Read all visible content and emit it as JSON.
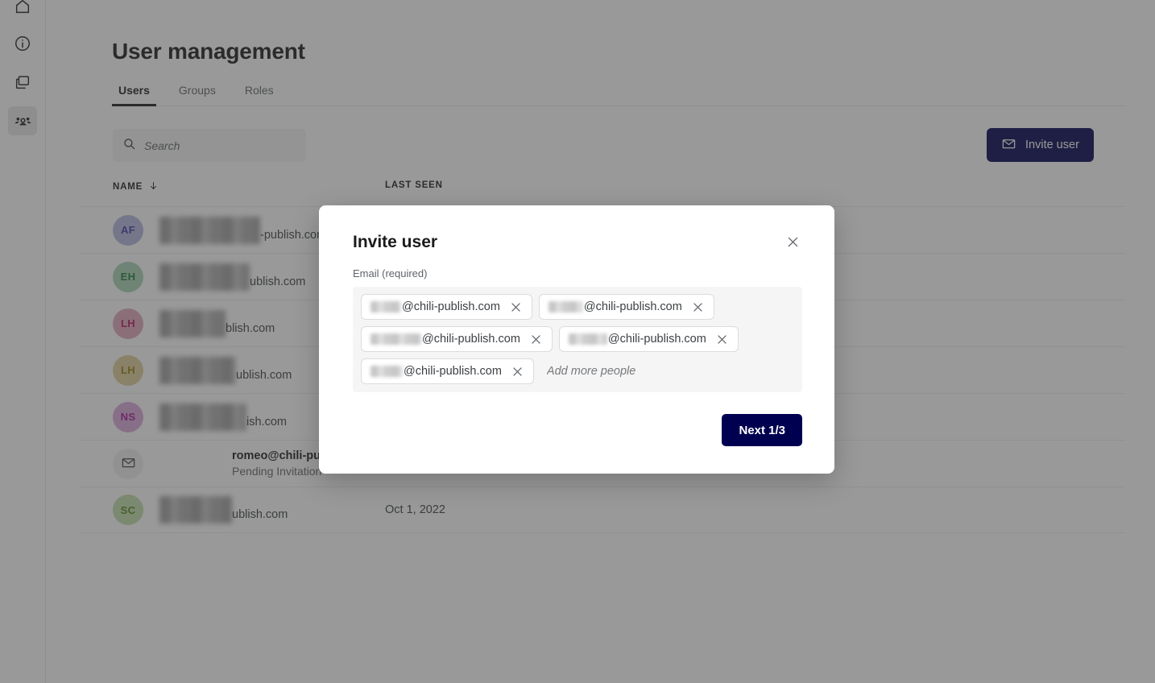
{
  "sidebar": {
    "items": [
      {
        "name": "home",
        "icon": "home-icon",
        "active": false
      },
      {
        "name": "info",
        "icon": "info-icon",
        "active": false
      },
      {
        "name": "workspaces",
        "icon": "window-stack-icon",
        "active": false
      },
      {
        "name": "user-management",
        "icon": "users-icon",
        "active": true
      }
    ]
  },
  "page": {
    "title": "User management",
    "tabs": [
      {
        "label": "Users",
        "active": true
      },
      {
        "label": "Groups",
        "active": false
      },
      {
        "label": "Roles",
        "active": false
      }
    ]
  },
  "toolbar": {
    "search_placeholder": "Search",
    "search_value": "",
    "search_icon": "search-icon",
    "invite_label": "Invite user",
    "invite_icon": "envelope-icon"
  },
  "table": {
    "columns": [
      {
        "key": "name",
        "label": "NAME",
        "sorted": true,
        "sort_icon": "arrow-down-icon"
      },
      {
        "key": "last_seen",
        "label": "LAST SEEN"
      }
    ],
    "rows": [
      {
        "initials": "AF",
        "avatar_color": "#b3b6de",
        "avatar_text_color": "#3f3fa8",
        "name_redacted": true,
        "name_blur_width": 125,
        "name_tail": "-publish.com",
        "badges": [
          "crown-icon",
          "pen-nib-icon"
        ],
        "last_seen": ""
      },
      {
        "initials": "EH",
        "avatar_color": "#a8d3b4",
        "avatar_text_color": "#1e7a44",
        "name_redacted": true,
        "name_blur_width": 112,
        "name_tail": "ublish.com",
        "badges": [],
        "last_seen": ""
      },
      {
        "initials": "LH",
        "avatar_color": "#dfa8bd",
        "avatar_text_color": "#b01a5a",
        "name_redacted": true,
        "name_blur_width": 82,
        "name_tail": "blish.com",
        "badges": [],
        "last_seen": ""
      },
      {
        "initials": "LH",
        "avatar_color": "#ddd09a",
        "avatar_text_color": "#9a7d0a",
        "name_redacted": true,
        "name_blur_width": 95,
        "name_tail": "ublish.com",
        "badges": [],
        "last_seen": ""
      },
      {
        "initials": "NS",
        "avatar_color": "#d9aad9",
        "avatar_text_color": "#a6199b",
        "name_redacted": true,
        "name_blur_width": 108,
        "name_tail": "ish.com",
        "badges": [],
        "last_seen": ""
      },
      {
        "initials": "",
        "avatar_color": "#eeeeee",
        "avatar_text_color": "#3c4043",
        "avatar_icon": "envelope-icon",
        "pending": true,
        "name_text": "romeo@chili-publish.com",
        "name_sub": "Pending Invitation",
        "badges": [],
        "last_seen": "-"
      },
      {
        "initials": "SC",
        "avatar_color": "#c3ddac",
        "avatar_text_color": "#4e8a1e",
        "name_redacted": true,
        "name_blur_width": 90,
        "name_tail": "ublish.com",
        "badges": [],
        "last_seen": "Oct 1, 2022"
      }
    ]
  },
  "modal": {
    "title": "Invite user",
    "close_icon": "close-icon",
    "field_label": "Email (required)",
    "chips": [
      {
        "blur_width": 38,
        "domain": "@chili-publish.com",
        "remove_icon": "close-icon"
      },
      {
        "blur_width": 43,
        "domain": "@chili-publish.com",
        "remove_icon": "close-icon"
      },
      {
        "blur_width": 63,
        "domain": "@chili-publish.com",
        "remove_icon": "close-icon"
      },
      {
        "blur_width": 48,
        "domain": "@chili-publish.com",
        "remove_icon": "close-icon"
      },
      {
        "blur_width": 40,
        "domain": "@chili-publish.com",
        "remove_icon": "close-icon"
      }
    ],
    "more_placeholder": "Add more people",
    "more_value": "",
    "next_label": "Next 1/3"
  },
  "colors": {
    "brand_navy": "#000050",
    "overlay": "rgba(60,60,60,0.52)",
    "field_bg": "#f5f5f5",
    "search_bg": "#f4f4f4",
    "text_primary": "#1b1b1b",
    "text_secondary": "#5f6368"
  }
}
